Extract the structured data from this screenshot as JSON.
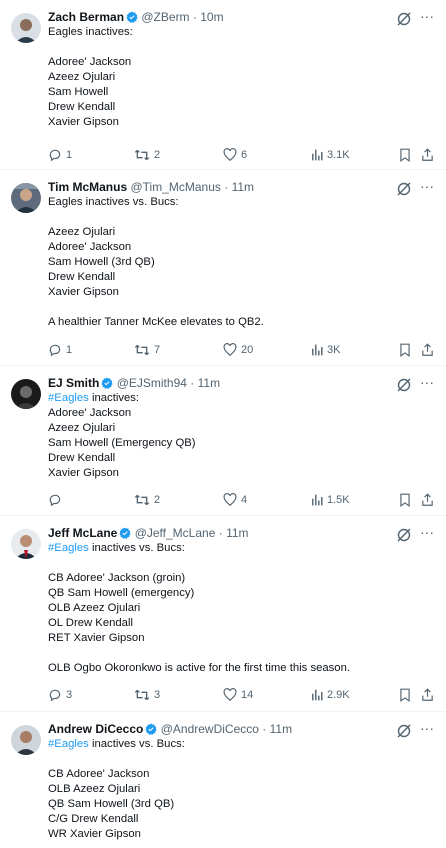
{
  "tweets": [
    {
      "name": "Zach Berman",
      "verified": true,
      "handle": "@ZBerm",
      "time": "10m",
      "lines": [
        "Eagles inactives:",
        "",
        "Adoree' Jackson",
        "Azeez Ojulari",
        "Sam Howell",
        "Drew Kendall",
        "Xavier Gipson"
      ],
      "replies": "1",
      "reposts": "2",
      "likes": "6",
      "views": "3.1K"
    },
    {
      "name": "Tim McManus",
      "verified": false,
      "handle": "@Tim_McManus",
      "time": "11m",
      "lines": [
        "Eagles inactives vs. Bucs:",
        "",
        "Azeez Ojulari",
        "Adoree' Jackson",
        "Sam Howell (3rd QB)",
        "Drew Kendall",
        "Xavier Gipson",
        "",
        "A healthier Tanner McKee elevates to QB2."
      ],
      "replies": "1",
      "reposts": "7",
      "likes": "20",
      "views": "3K"
    },
    {
      "name": "EJ Smith",
      "verified": true,
      "handle": "@EJSmith94",
      "time": "11m",
      "hashtag": "#Eagles",
      "first_rest": " inactives:",
      "lines": [
        "Adoree' Jackson",
        "Azeez Ojulari",
        "Sam Howell (Emergency QB)",
        "Drew Kendall",
        "Xavier Gipson"
      ],
      "replies": "",
      "reposts": "2",
      "likes": "4",
      "views": "1.5K"
    },
    {
      "name": "Jeff McLane",
      "verified": true,
      "handle": "@Jeff_McLane",
      "time": "11m",
      "hashtag": "#Eagles",
      "first_rest": " inactives vs. Bucs:",
      "lines": [
        "",
        "CB Adoree' Jackson (groin)",
        "QB Sam Howell (emergency)",
        "OLB Azeez Ojulari",
        "OL Drew Kendall",
        "RET Xavier Gipson",
        "",
        "OLB Ogbo Okoronkwo is active for the first time this season."
      ],
      "replies": "3",
      "reposts": "3",
      "likes": "14",
      "views": "2.9K"
    },
    {
      "name": "Andrew DiCecco",
      "verified": true,
      "handle": "@AndrewDiCecco",
      "time": "11m",
      "hashtag": "#Eagles",
      "first_rest": " inactives vs. Bucs:",
      "lines": [
        "",
        "CB Adoree' Jackson",
        "OLB Azeez Ojulari",
        "QB Sam Howell (3rd QB)",
        "C/G Drew Kendall",
        "WR Xavier Gipson"
      ],
      "replies": "",
      "reposts": "",
      "likes": "",
      "views": ""
    }
  ],
  "separator": "·",
  "more_glyph": "···",
  "icons": [
    "reply-icon",
    "repost-icon",
    "like-icon",
    "views-icon",
    "bookmark-icon",
    "share-icon",
    "grok-icon",
    "verified-icon"
  ],
  "colors": {
    "accent": "#1d9bf0",
    "text": "#0f1419",
    "muted": "#536471",
    "border": "#eff3f4"
  }
}
